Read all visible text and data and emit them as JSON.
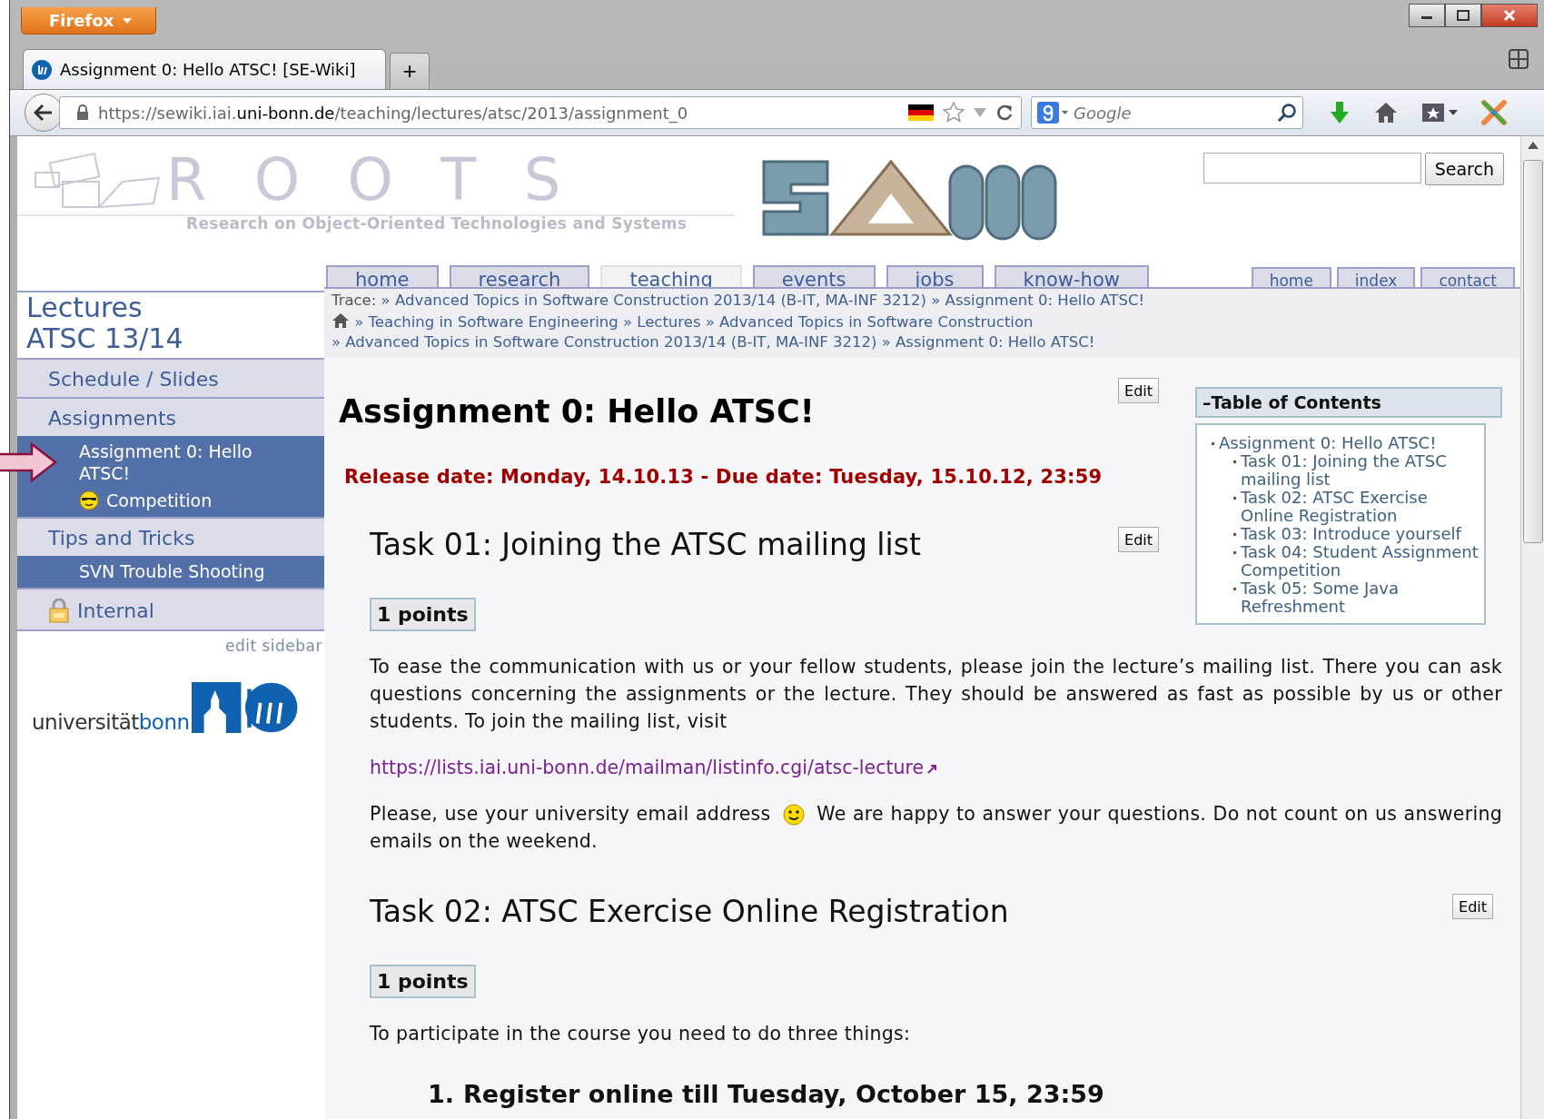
{
  "browser": {
    "app_button": "Firefox",
    "tab_title": "Assignment 0: Hello ATSC! [SE-Wiki]",
    "new_tab": "+",
    "url": {
      "prefix": "https://sewiki.iai.",
      "domain": "uni-bonn.de",
      "path": "/teaching/lectures/atsc/2013/assignment_0"
    },
    "search_placeholder": "Google"
  },
  "site": {
    "logo_letters": "R O O T S",
    "tagline": "Research on Object-Oriented Technologies and Systems",
    "search_button": "Search"
  },
  "main_nav": [
    {
      "label": "home",
      "selected": false
    },
    {
      "label": "research",
      "selected": false
    },
    {
      "label": "teaching",
      "selected": true
    },
    {
      "label": "events",
      "selected": false
    },
    {
      "label": "jobs",
      "selected": false
    },
    {
      "label": "know-how",
      "selected": false
    }
  ],
  "util_nav": [
    "home",
    "index",
    "contact"
  ],
  "sidebar": {
    "title": [
      "Lectures",
      "ATSC 13/14"
    ],
    "items": [
      {
        "label": "Schedule / Slides",
        "kind": "plain"
      },
      {
        "label": "Assignments",
        "kind": "plain",
        "children": [
          {
            "label": "Assignment 0: Hello ATSC!",
            "kind": "plain"
          },
          {
            "label": "Competition",
            "kind": "smiley"
          }
        ]
      },
      {
        "label": "Tips and Tricks",
        "kind": "plain",
        "children": [
          {
            "label": "SVN Trouble Shooting",
            "kind": "plain"
          }
        ]
      },
      {
        "label": "Internal",
        "kind": "lock"
      }
    ],
    "edit_link": "edit sidebar",
    "university_logo": {
      "plain": "universität",
      "bold": "bonn"
    }
  },
  "trace": {
    "label": "Trace:",
    "items": [
      "» Advanced Topics in Software Construction 2013/14 (B-IT, MA-INF 3212)",
      "» Assignment 0: Hello ATSC!"
    ]
  },
  "breadcrumb": [
    "» Teaching in Software Engineering",
    "» Lectures",
    "» Advanced Topics in Software Construction",
    "» Advanced Topics in Software Construction 2013/14 (B-IT, MA-INF 3212)",
    "» Assignment 0: Hello ATSC!"
  ],
  "page": {
    "title": "Assignment 0: Hello ATSC!",
    "edit": "Edit",
    "release": "Release date: Monday, 14.10.13 - Due date: Tuesday, 15.10.12, 23:59",
    "toc": {
      "toggle": "–",
      "title": "Table of Contents",
      "items": [
        {
          "label": "Assignment 0: Hello ATSC!",
          "children": [
            {
              "label": "Task 01: Joining the ATSC mailing list"
            },
            {
              "label": "Task 02: ATSC Exercise Online Registration"
            },
            {
              "label": "Task 03: Introduce yourself"
            },
            {
              "label": "Task 04: Student Assignment Competition"
            },
            {
              "label": "Task 05: Some Java Refreshment"
            }
          ]
        }
      ]
    },
    "sections": [
      {
        "heading": "Task 01: Joining the ATSC mailing list",
        "edit": "Edit",
        "points": "1 points",
        "body": [
          {
            "kind": "paragraph",
            "text": "To ease the communication with us or your fellow students, please join the lecture’s mailing list. There you can ask questions concerning the assignments or the lecture. They should be answered as fast as possible by us or other students. To join the mailing list, visit"
          },
          {
            "kind": "link",
            "text": "https://lists.iai.uni-bonn.de/mailman/listinfo.cgi/atsc-lecture"
          },
          {
            "kind": "emoticon_paragraph",
            "before": "Please, use your university email address",
            "after": "We are happy to answer your questions. Do not count on us answering emails on the weekend."
          }
        ]
      },
      {
        "heading": "Task 02: ATSC Exercise Online Registration",
        "edit": "Edit",
        "points": "1 points",
        "body": [
          {
            "kind": "paragraph",
            "text": "To participate in the course you need to do three things:"
          },
          {
            "kind": "numbered_heading",
            "number": "1.",
            "text": "Register online till Tuesday, October 15, 23:59"
          }
        ]
      }
    ]
  }
}
